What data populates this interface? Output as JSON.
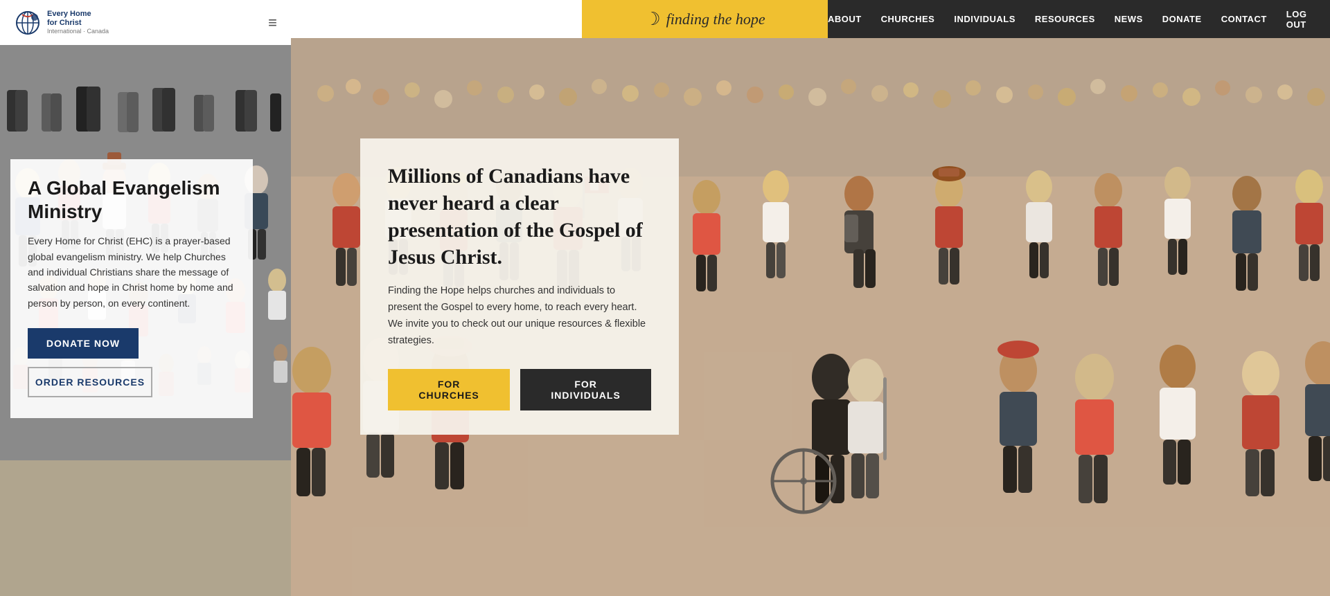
{
  "site": {
    "logo_symbol": "☽",
    "logo_name": "finding the hope",
    "nav_links": [
      {
        "label": "ABOUT",
        "name": "about"
      },
      {
        "label": "CHURCHES",
        "name": "churches"
      },
      {
        "label": "INDIVIDUALS",
        "name": "individuals"
      },
      {
        "label": "RESOURCES",
        "name": "resources"
      },
      {
        "label": "NEWS",
        "name": "news"
      },
      {
        "label": "DONATE",
        "name": "donate"
      },
      {
        "label": "CONTACT",
        "name": "contact"
      },
      {
        "label": "LOG OUT",
        "name": "log-out"
      }
    ]
  },
  "mobile": {
    "org_name_line1": "Every Home",
    "org_name_line2": "for Christ",
    "org_name_line3": "International · Canada",
    "hamburger_icon": "≡"
  },
  "left_card": {
    "title": "A Global Evangelism Ministry",
    "body": "Every Home for Christ (EHC) is a prayer-based global evangelism ministry. We help Churches and individual Christians share the message of salvation and hope in Christ home by home and person by person, on every continent.",
    "donate_button": "DONATE NOW",
    "order_button": "ORDER RESOURCES"
  },
  "main_content": {
    "headline": "Millions of Canadians have never heard a clear presentation of the Gospel of Jesus Christ.",
    "body": "Finding the Hope helps churches and individuals to present the Gospel to every home, to reach every heart. We invite you to check out our unique resources & flexible strategies.",
    "btn_churches": "FOR CHURCHES",
    "btn_individuals": "FOR INDIVIDUALS"
  },
  "colors": {
    "nav_bg": "#2a2a2a",
    "logo_bg": "#f0c030",
    "donate_btn_bg": "#1a3a6b",
    "churches_btn_bg": "#f0c030",
    "individuals_btn_bg": "#2a2a2a",
    "content_box_bg": "rgba(245,242,235,0.95)"
  }
}
